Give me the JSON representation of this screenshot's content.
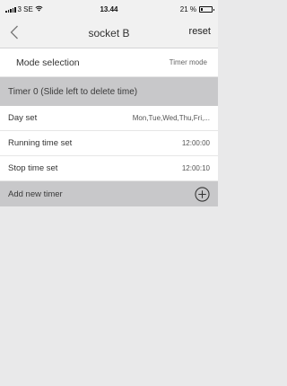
{
  "status_bar": {
    "carrier": "3 SE",
    "time": "13.44",
    "battery": "21 %",
    "battery_level": 0.21
  },
  "nav": {
    "title": "socket B",
    "reset_label": "reset"
  },
  "mode_selection": {
    "label": "Mode selection",
    "value": "Timer mode"
  },
  "timer": {
    "header": "Timer 0 (Slide left to delete time)",
    "rows": [
      {
        "label": "Day set",
        "value": "Mon,Tue,Wed,Thu,Fri,..."
      },
      {
        "label": "Running time set",
        "value": "12:00:00"
      },
      {
        "label": "Stop time set",
        "value": "12:00:10"
      }
    ]
  },
  "add_timer": {
    "label": "Add new timer"
  },
  "icons": {
    "back": "chevron-left-icon",
    "add": "plus-circle-icon",
    "wifi": "wifi-icon",
    "signal": "signal-icon",
    "battery": "battery-icon"
  }
}
